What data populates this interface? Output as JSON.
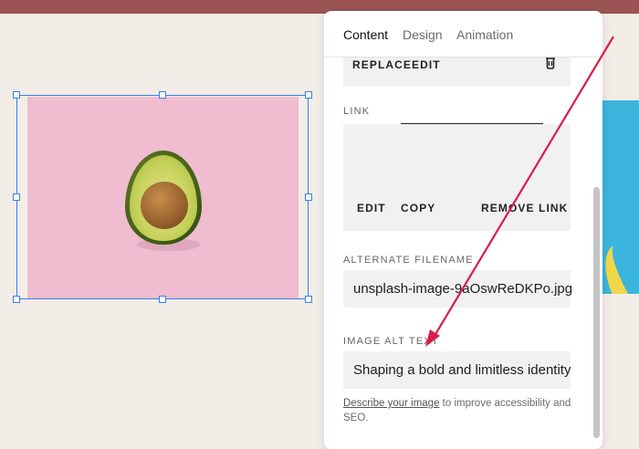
{
  "panel": {
    "tabs": [
      {
        "label": "Content",
        "active": true
      },
      {
        "label": "Design",
        "active": false
      },
      {
        "label": "Animation",
        "active": false
      }
    ],
    "image_actions": {
      "replace": "REPLACE",
      "edit": "EDIT",
      "delete_icon": "trash-icon"
    },
    "link": {
      "label": "LINK",
      "edit": "EDIT",
      "copy": "COPY",
      "remove": "REMOVE LINK"
    },
    "alternate_filename": {
      "label": "ALTERNATE FILENAME",
      "value": "unsplash-image-9aOswReDKPo.jpg"
    },
    "image_alt_text": {
      "label": "IMAGE ALT TEXT",
      "value": "Shaping a bold and limitless identity"
    },
    "help": {
      "link_text": "Describe your image",
      "rest": " to improve accessibility and SEO."
    }
  },
  "colors": {
    "topbar": "#9a5454",
    "selection": "#3b7cf0",
    "annotation_arrow": "#d81e4a",
    "photo_background": "#efbcd0"
  }
}
